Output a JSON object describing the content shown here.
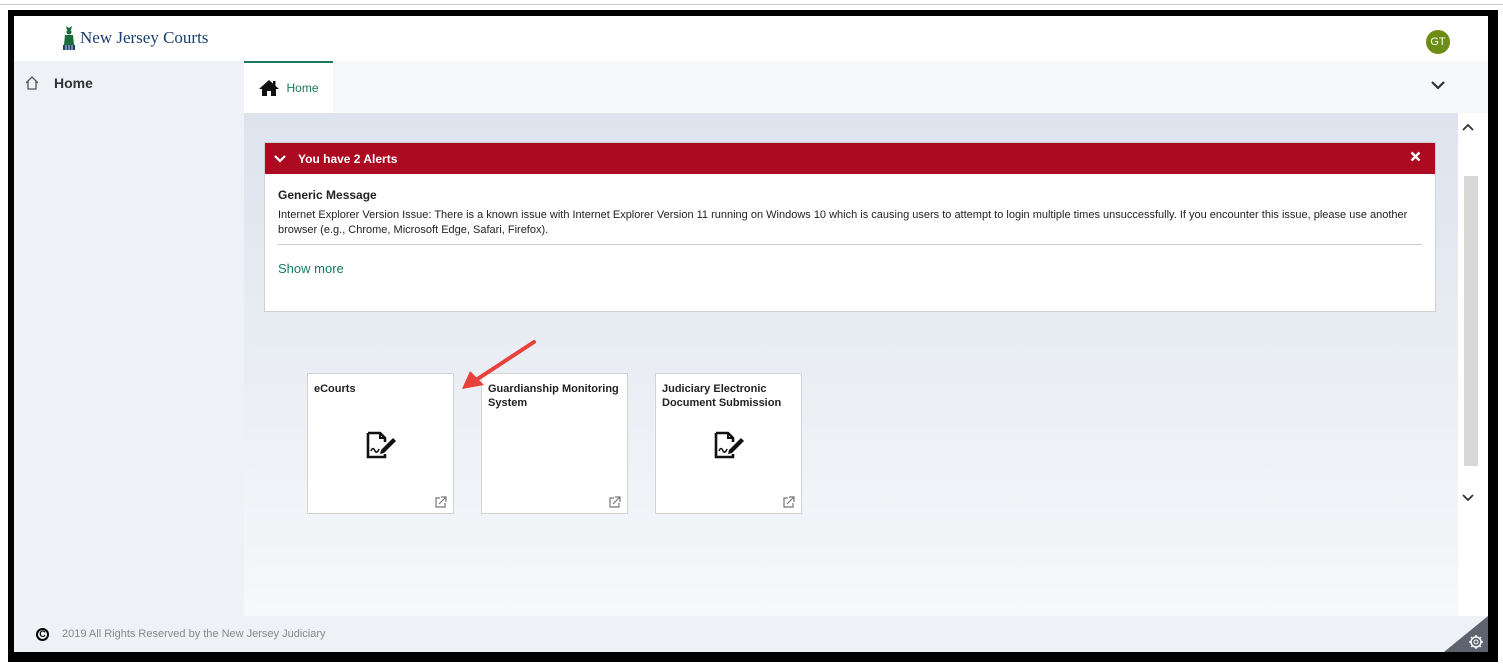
{
  "header": {
    "logo_text": "New Jersey Courts",
    "avatar_initials": "GT"
  },
  "sidebar": {
    "items": [
      {
        "label": "Home",
        "icon": "home-outline-icon"
      }
    ]
  },
  "tabs": [
    {
      "label": "Home",
      "icon": "home-icon",
      "active": true
    }
  ],
  "alert": {
    "header": "You have 2 Alerts",
    "title": "Generic Message",
    "text": "Internet Explorer Version Issue: There is a known issue with Internet Explorer Version 11 running on Windows 10 which is causing users to attempt to login multiple times unsuccessfully. If you encounter this issue, please use another browser (e.g., Chrome, Microsoft Edge, Safari, Firefox).",
    "show_more": "Show more",
    "color": "#ac0a20"
  },
  "tiles": [
    {
      "title": "eCourts",
      "icon": "signed-document-icon"
    },
    {
      "title": "Guardianship Monitoring System",
      "icon": ""
    },
    {
      "title": "Judiciary Electronic Document Submission",
      "icon": "signed-document-icon"
    }
  ],
  "footer": {
    "copyright_symbol": "C",
    "text": "2019 All Rights Reserved by the New Jersey Judiciary"
  },
  "colors": {
    "accent": "#1a7a5e",
    "alert": "#ac0a20",
    "avatar": "#6b8e12",
    "annotation_arrow": "#e8403a"
  }
}
